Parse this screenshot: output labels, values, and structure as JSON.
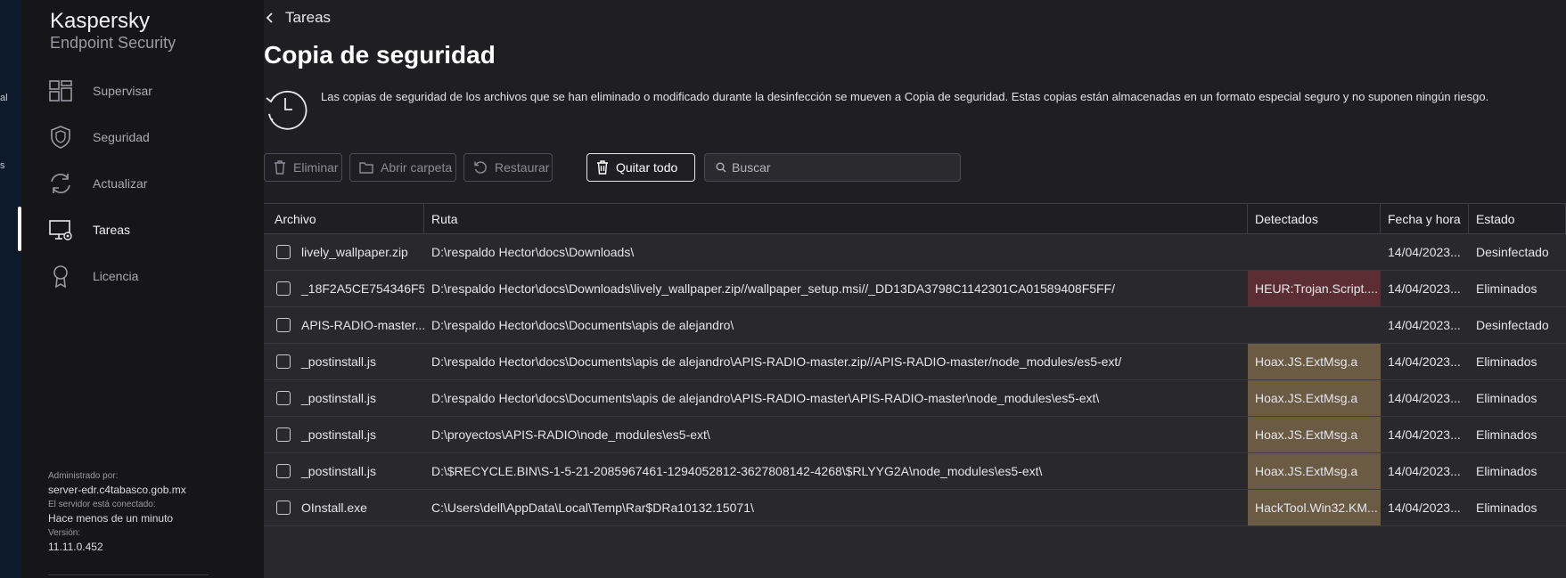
{
  "edge": {
    "fragment_1": "al",
    "fragment_2": "s"
  },
  "brand": {
    "line1": "Kaspersky",
    "line2": "Endpoint Security"
  },
  "nav": [
    {
      "label": "Supervisar",
      "icon": "dashboard-icon"
    },
    {
      "label": "Seguridad",
      "icon": "shield-icon"
    },
    {
      "label": "Actualizar",
      "icon": "refresh-icon"
    },
    {
      "label": "Tareas",
      "icon": "tasks-monitor-icon",
      "active": true
    },
    {
      "label": "Licencia",
      "icon": "license-ribbon-icon"
    }
  ],
  "status": {
    "managed_label": "Administrado por:",
    "managed_value": "server-edr.c4tabasco.gob.mx",
    "connected_label": "El servidor está conectado:",
    "connected_value": "Hace menos de un minuto",
    "version_label": "Versión:",
    "version_value": "11.11.0.452"
  },
  "header": {
    "back_label": "Tareas",
    "title": "Copia de seguridad",
    "description": "Las copias de seguridad de los archivos que se han eliminado o modificado durante la desinfección se mueven a Copia de seguridad. Estas copias están almacenadas en un formato especial seguro y no suponen ningún riesgo."
  },
  "toolbar": {
    "delete_label": "Eliminar",
    "open_folder_label": "Abrir carpeta",
    "restore_label": "Restaurar",
    "remove_all_label": "Quitar todo",
    "search_placeholder": "Buscar"
  },
  "table": {
    "columns": [
      "Archivo",
      "Ruta",
      "Detectados",
      "Fecha y hora",
      "Estado"
    ],
    "rows": [
      {
        "file": "lively_wallpaper.zip",
        "path": "D:\\respaldo Hector\\docs\\Downloads\\",
        "detected": "",
        "date": "14/04/2023...",
        "status": "Desinfectado"
      },
      {
        "file": "_18F2A5CE754346F5...",
        "path": "D:\\respaldo Hector\\docs\\Downloads\\lively_wallpaper.zip//wallpaper_setup.msi//_DD13DA3798C1142301CA01589408F5FF/",
        "detected": "HEUR:Trojan.Script....",
        "date": "14/04/2023...",
        "status": "Eliminados"
      },
      {
        "file": "APIS-RADIO-master....",
        "path": "D:\\respaldo Hector\\docs\\Documents\\apis de alejandro\\",
        "detected": "",
        "date": "14/04/2023...",
        "status": "Desinfectado"
      },
      {
        "file": "_postinstall.js",
        "path": "D:\\respaldo Hector\\docs\\Documents\\apis de alejandro\\APIS-RADIO-master.zip//APIS-RADIO-master/node_modules/es5-ext/",
        "detected": "Hoax.JS.ExtMsg.a",
        "date": "14/04/2023...",
        "status": "Eliminados"
      },
      {
        "file": "_postinstall.js",
        "path": "D:\\respaldo Hector\\docs\\Documents\\apis de alejandro\\APIS-RADIO-master\\APIS-RADIO-master\\node_modules\\es5-ext\\",
        "detected": "Hoax.JS.ExtMsg.a",
        "date": "14/04/2023...",
        "status": "Eliminados"
      },
      {
        "file": "_postinstall.js",
        "path": "D:\\proyectos\\APIS-RADIO\\node_modules\\es5-ext\\",
        "detected": "Hoax.JS.ExtMsg.a",
        "date": "14/04/2023...",
        "status": "Eliminados"
      },
      {
        "file": "_postinstall.js",
        "path": "D:\\$RECYCLE.BIN\\S-1-5-21-2085967461-1294052812-3627808142-4268\\$RLYYG2A\\node_modules\\es5-ext\\",
        "detected": "Hoax.JS.ExtMsg.a",
        "date": "14/04/2023...",
        "status": "Eliminados"
      },
      {
        "file": "OInstall.exe",
        "path": "C:\\Users\\dell\\AppData\\Local\\Temp\\Rar$DRa10132.15071\\",
        "detected": "HackTool.Win32.KM...",
        "date": "14/04/2023...",
        "status": "Eliminados"
      }
    ]
  },
  "colors": {
    "trojan_highlight": "#5b2e33",
    "hoax_highlight": "#6b5a44",
    "sidebar_bg": "#161618",
    "main_bg": "#1f1f23"
  }
}
